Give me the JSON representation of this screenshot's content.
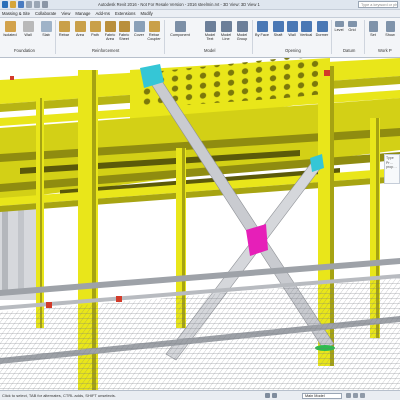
{
  "titlebar": {
    "title": "Autodesk Revit 2016 - Not For Resale Version -  2016 steelmin.rvt - 3D View: 3D View 1",
    "search_placeholder": "Type a keyword or phra"
  },
  "tabs": [
    {
      "label": "Massing & Site"
    },
    {
      "label": "Collaborate"
    },
    {
      "label": "View"
    },
    {
      "label": "Manage"
    },
    {
      "label": "Add-Ins"
    },
    {
      "label": "Extensions"
    },
    {
      "label": "Modify"
    }
  ],
  "ribbon": {
    "buttons": [
      {
        "label": "Isolated",
        "icon": "isolated-foundation-icon",
        "color": "#d2a24c"
      },
      {
        "label": "Wall",
        "icon": "wall-foundation-icon",
        "color": "#b9b9b9"
      },
      {
        "label": "Slab",
        "icon": "slab-foundation-icon",
        "color": "#9fb3c8"
      },
      {
        "label": "Rebar",
        "icon": "rebar-icon",
        "color": "#c9a04a"
      },
      {
        "label": "Area",
        "icon": "area-reinforcement-icon",
        "color": "#c9a04a"
      },
      {
        "label": "Path",
        "icon": "path-reinforcement-icon",
        "color": "#c9a04a"
      },
      {
        "label": "Fabric Area",
        "icon": "fabric-area-icon",
        "color": "#b98f3c"
      },
      {
        "label": "Fabric Sheet",
        "icon": "fabric-sheet-icon",
        "color": "#b98f3c"
      },
      {
        "label": "Cover",
        "icon": "cover-icon",
        "color": "#8aa0b8"
      },
      {
        "label": "Rebar Coupler",
        "icon": "rebar-coupler-icon",
        "color": "#c9a04a"
      },
      {
        "label": "Component",
        "icon": "component-icon",
        "color": "#7c8fa6"
      },
      {
        "label": "Model Text",
        "icon": "model-text-icon",
        "color": "#6c7f99"
      },
      {
        "label": "Model Line",
        "icon": "model-line-icon",
        "color": "#6c7f99"
      },
      {
        "label": "Model Group",
        "icon": "model-group-icon",
        "color": "#6c7f99"
      },
      {
        "label": "By Face",
        "icon": "by-face-icon",
        "color": "#4a78b5"
      },
      {
        "label": "Shaft",
        "icon": "shaft-icon",
        "color": "#4a78b5"
      },
      {
        "label": "Wall",
        "icon": "opening-wall-icon",
        "color": "#4a78b5"
      },
      {
        "label": "Vertical",
        "icon": "vertical-opening-icon",
        "color": "#4a78b5"
      },
      {
        "label": "Dormer",
        "icon": "dormer-icon",
        "color": "#4a78b5"
      },
      {
        "label": "Level",
        "icon": "level-icon",
        "color": "#7f93aa"
      },
      {
        "label": "Grid",
        "icon": "grid-icon",
        "color": "#7f93aa"
      },
      {
        "label": "Set",
        "icon": "set-work-plane-icon",
        "color": "#7f93aa"
      },
      {
        "label": "Show",
        "icon": "show-work-plane-icon",
        "color": "#7f93aa"
      }
    ],
    "panels": [
      {
        "label": "Foundation"
      },
      {
        "label": "Reinforcement"
      },
      {
        "label": "Model"
      },
      {
        "label": "Opening"
      },
      {
        "label": "Datum"
      },
      {
        "label": "Work P"
      }
    ]
  },
  "props_peek": {
    "text": "Type Pr… prop…"
  },
  "statusbar": {
    "message": "Click to select, TAB for alternates, CTRL adds, SHIFT unselects.",
    "scale_label": "0",
    "model": "Main Model"
  },
  "colors": {
    "steel_yellow": "#e9e61a",
    "steel_dark": "#8f8c10",
    "brace_gray": "#c9cbd0",
    "plate_magenta": "#e61fb8",
    "plate_cyan": "#35c6d6",
    "base_green": "#2bbf4c",
    "rail_gray": "#9ea2a8"
  }
}
